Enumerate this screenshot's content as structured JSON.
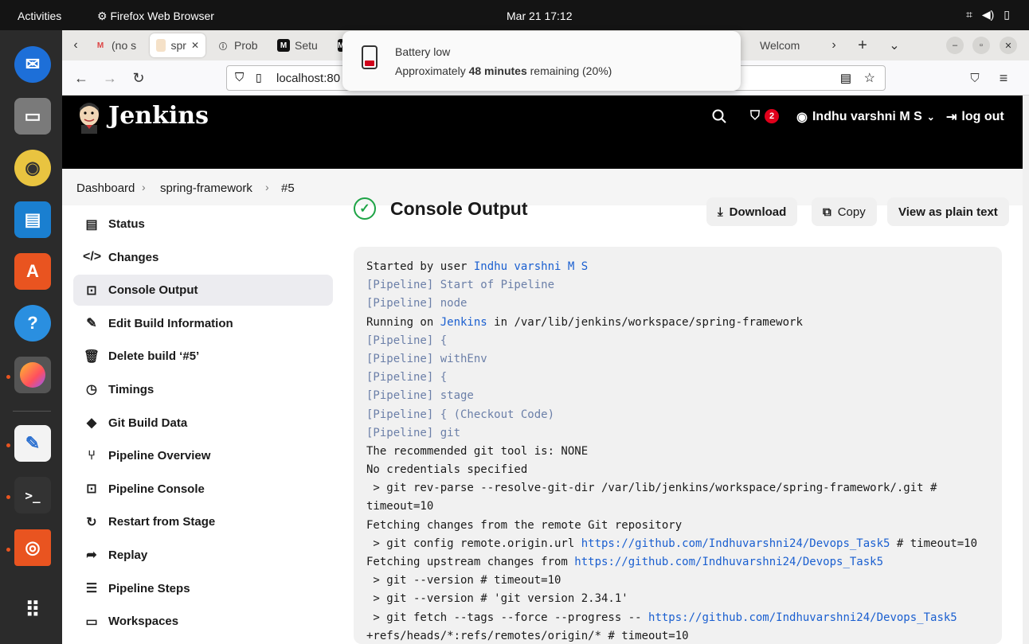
{
  "system": {
    "activities": "Activities",
    "app_name": "Firefox Web Browser",
    "clock": "Mar 21  17:12"
  },
  "browser": {
    "tabs": [
      {
        "label": "(no s",
        "favicon": "M"
      },
      {
        "label": "spr",
        "favicon": "J"
      },
      {
        "label": "Prob",
        "favicon": "ⓘ"
      },
      {
        "label": "Setu",
        "favicon": "M"
      },
      {
        "label": "",
        "favicon": "M"
      },
      {
        "label": "Welcom",
        "favicon": ""
      }
    ],
    "url": "localhost:80"
  },
  "notification": {
    "title": "Battery low",
    "body_prefix": "Approximately ",
    "body_bold": "48 minutes",
    "body_suffix": " remaining (20%)"
  },
  "jenkins": {
    "brand": "Jenkins",
    "alert_count": "2",
    "user": "Indhu varshni M S",
    "logout": "log out"
  },
  "breadcrumb": [
    "Dashboard",
    "spring-framework",
    "#5"
  ],
  "sidebar": [
    {
      "label": "Status",
      "icon": "status-icon"
    },
    {
      "label": "Changes",
      "icon": "code-icon"
    },
    {
      "label": "Console Output",
      "icon": "terminal-icon",
      "active": true
    },
    {
      "label": "Edit Build Information",
      "icon": "edit-icon"
    },
    {
      "label": "Delete build ‘#5’",
      "icon": "trash-icon"
    },
    {
      "label": "Timings",
      "icon": "timer-icon"
    },
    {
      "label": "Git Build Data",
      "icon": "git-icon"
    },
    {
      "label": "Pipeline Overview",
      "icon": "pipeline-icon"
    },
    {
      "label": "Pipeline Console",
      "icon": "terminal-icon"
    },
    {
      "label": "Restart from Stage",
      "icon": "restart-icon"
    },
    {
      "label": "Replay",
      "icon": "replay-icon"
    },
    {
      "label": "Pipeline Steps",
      "icon": "steps-icon"
    },
    {
      "label": "Workspaces",
      "icon": "folder-icon"
    }
  ],
  "main": {
    "title": "Console Output",
    "download": "Download",
    "copy": "Copy",
    "plain_text": "View as plain text"
  },
  "console_lines": [
    [
      {
        "t": "Started by user "
      },
      {
        "t": "Indhu varshni M S",
        "c": "link"
      }
    ],
    [
      {
        "t": "[Pipeline] Start of Pipeline",
        "c": "pipe"
      }
    ],
    [
      {
        "t": "[Pipeline] node",
        "c": "pipe"
      }
    ],
    [
      {
        "t": "Running on "
      },
      {
        "t": "Jenkins",
        "c": "link"
      },
      {
        "t": " in /var/lib/jenkins/workspace/spring-framework"
      }
    ],
    [
      {
        "t": "[Pipeline] {",
        "c": "pipe"
      }
    ],
    [
      {
        "t": "[Pipeline] withEnv",
        "c": "pipe"
      }
    ],
    [
      {
        "t": "[Pipeline] {",
        "c": "pipe"
      }
    ],
    [
      {
        "t": "[Pipeline] stage",
        "c": "pipe"
      }
    ],
    [
      {
        "t": "[Pipeline] { (Checkout Code)",
        "c": "pipe"
      }
    ],
    [
      {
        "t": "[Pipeline] git",
        "c": "pipe"
      }
    ],
    [
      {
        "t": "The recommended git tool is: NONE"
      }
    ],
    [
      {
        "t": "No credentials specified"
      }
    ],
    [
      {
        "t": " > git rev-parse --resolve-git-dir /var/lib/jenkins/workspace/spring-framework/.git #"
      }
    ],
    [
      {
        "t": "timeout=10"
      }
    ],
    [
      {
        "t": "Fetching changes from the remote Git repository"
      }
    ],
    [
      {
        "t": " > git config remote.origin.url "
      },
      {
        "t": "https://github.com/Indhuvarshni24/Devops_Task5",
        "c": "link"
      },
      {
        "t": " # timeout=10"
      }
    ],
    [
      {
        "t": "Fetching upstream changes from "
      },
      {
        "t": "https://github.com/Indhuvarshni24/Devops_Task5",
        "c": "link"
      }
    ],
    [
      {
        "t": " > git --version # timeout=10"
      }
    ],
    [
      {
        "t": " > git --version # 'git version 2.34.1'"
      }
    ],
    [
      {
        "t": " > git fetch --tags --force --progress -- "
      },
      {
        "t": "https://github.com/Indhuvarshni24/Devops_Task5",
        "c": "link"
      }
    ],
    [
      {
        "t": "+refs/heads/*:refs/remotes/origin/* # timeout=10"
      }
    ]
  ]
}
